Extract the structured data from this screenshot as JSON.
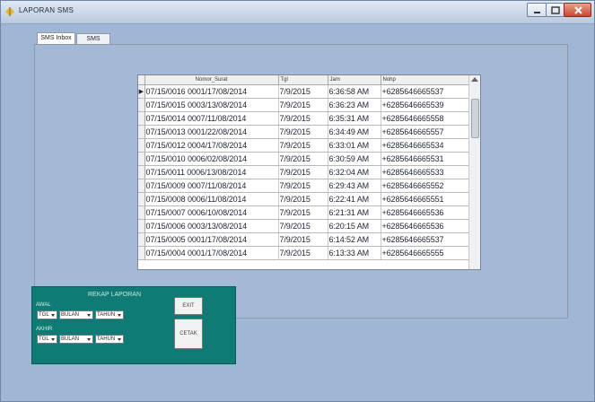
{
  "window": {
    "title": "LAPORAN SMS",
    "accent": "#0f7b74",
    "bg": "#9fb6d4"
  },
  "tabs": [
    "SMS Inbox",
    "SMS Outbox"
  ],
  "grid": {
    "columns": [
      "",
      "Nomor_Surat",
      "Tgl",
      "Jam",
      "Nohp"
    ],
    "rows": [
      {
        "marker": "▶",
        "surat": "07/15/0016 0001/17/08/2014",
        "tgl": "7/9/2015",
        "jam": "6:36:58 AM",
        "nohp": "+6285646665537"
      },
      {
        "marker": "",
        "surat": "07/15/0015 0003/13/08/2014",
        "tgl": "7/9/2015",
        "jam": "6:36:23 AM",
        "nohp": "+6285646665539"
      },
      {
        "marker": "",
        "surat": "07/15/0014 0007/11/08/2014",
        "tgl": "7/9/2015",
        "jam": "6:35:31 AM",
        "nohp": "+6285646665558"
      },
      {
        "marker": "",
        "surat": "07/15/0013 0001/22/08/2014",
        "tgl": "7/9/2015",
        "jam": "6:34:49 AM",
        "nohp": "+6285646665557"
      },
      {
        "marker": "",
        "surat": "07/15/0012 0004/17/08/2014",
        "tgl": "7/9/2015",
        "jam": "6:33:01 AM",
        "nohp": "+6285646665534"
      },
      {
        "marker": "",
        "surat": "07/15/0010 0006/02/08/2014",
        "tgl": "7/9/2015",
        "jam": "6:30:59 AM",
        "nohp": "+6285646665531"
      },
      {
        "marker": "",
        "surat": "07/15/0011 0006/13/08/2014",
        "tgl": "7/9/2015",
        "jam": "6:32:04 AM",
        "nohp": "+6285646665533"
      },
      {
        "marker": "",
        "surat": "07/15/0009 0007/11/08/2014",
        "tgl": "7/9/2015",
        "jam": "6:29:43 AM",
        "nohp": "+6285646665552"
      },
      {
        "marker": "",
        "surat": "07/15/0008 0006/11/08/2014",
        "tgl": "7/9/2015",
        "jam": "6:22:41 AM",
        "nohp": "+6285646665551"
      },
      {
        "marker": "",
        "surat": "07/15/0007 0006/10/08/2014",
        "tgl": "7/9/2015",
        "jam": "6:21:31 AM",
        "nohp": "+6285646665536"
      },
      {
        "marker": "",
        "surat": "07/15/0006 0003/13/08/2014",
        "tgl": "7/9/2015",
        "jam": "6:20:15 AM",
        "nohp": "+6285646665536"
      },
      {
        "marker": "",
        "surat": "07/15/0005 0001/17/08/2014",
        "tgl": "7/9/2015",
        "jam": "6:14:52 AM",
        "nohp": "+6285646665537"
      },
      {
        "marker": "",
        "surat": "07/15/0004 0001/17/08/2014",
        "tgl": "7/9/2015",
        "jam": "6:13:33 AM",
        "nohp": "+6285646665555"
      }
    ]
  },
  "report": {
    "title": "REKAP LAPORAN",
    "awal_label": "AWAL",
    "akhir_label": "AKHIR",
    "awal": {
      "tgl": "TGL",
      "bulan": "BULAN",
      "tahun": "TAHUN"
    },
    "akhir": {
      "tgl": "TGL",
      "bulan": "BULAN",
      "tahun": "TAHUN"
    },
    "exit_label": "EXIT",
    "cetak_label": "CETAK"
  }
}
